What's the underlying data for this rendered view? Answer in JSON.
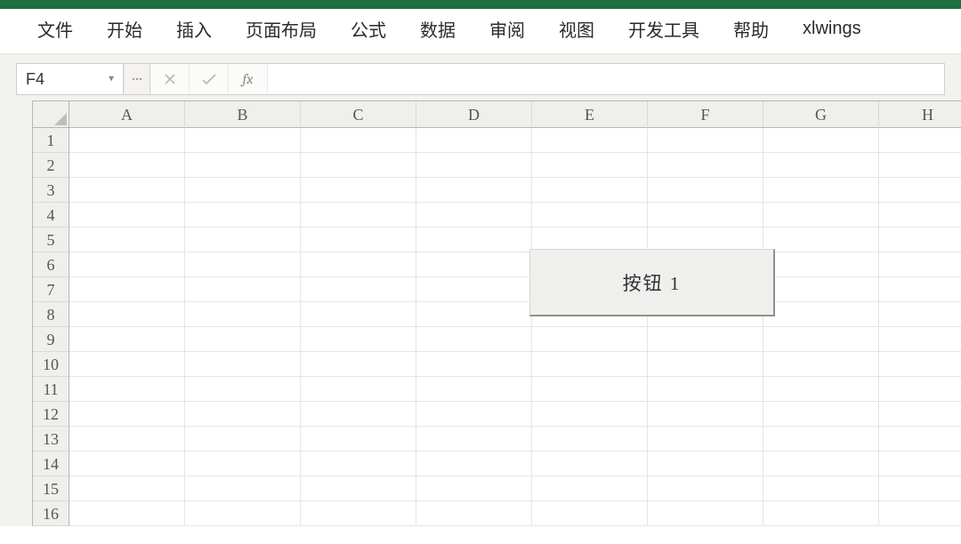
{
  "ribbon": {
    "tabs": [
      "文件",
      "开始",
      "插入",
      "页面布局",
      "公式",
      "数据",
      "审阅",
      "视图",
      "开发工具",
      "帮助",
      "xlwings"
    ]
  },
  "formula_bar": {
    "name_box": "F4",
    "fx_label": "fx",
    "formula": ""
  },
  "grid": {
    "columns": [
      "A",
      "B",
      "C",
      "D",
      "E",
      "F",
      "G",
      "H"
    ],
    "rows": [
      "1",
      "2",
      "3",
      "4",
      "5",
      "6",
      "7",
      "8",
      "9",
      "10",
      "11",
      "12",
      "13",
      "14",
      "15",
      "16"
    ]
  },
  "button": {
    "label": "按钮 1"
  }
}
